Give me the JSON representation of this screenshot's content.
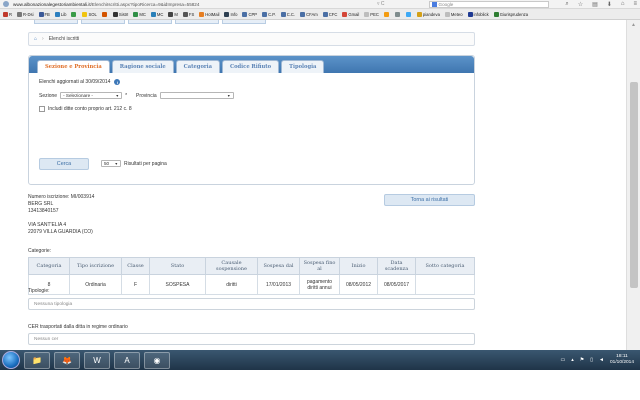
{
  "browser": {
    "url_host": "www.albonazionalegestoriambientali.it",
    "url_path": "/ElenchiIscritti.aspx?tipoRicerca=9&idImpresa=55824",
    "search_placeholder": "Google",
    "bookmarks": [
      {
        "label": "R",
        "icon": "r-icon",
        "color": "#c0392b"
      },
      {
        "label": "R-Dsi",
        "icon": "bookmark-icon",
        "color": "#777777"
      },
      {
        "label": "FB",
        "icon": "facebook-icon",
        "color": "#3b5998"
      },
      {
        "label": "Lib",
        "icon": "bookmark-icon",
        "color": "#2c7fbf"
      },
      {
        "label": "",
        "icon": "bookmark-icon",
        "color": "#3a9c47"
      },
      {
        "label": "SOL",
        "icon": "warning-icon",
        "color": "#f1c40f"
      },
      {
        "label": "",
        "icon": "bookmark-icon",
        "color": "#d35400"
      },
      {
        "label": "SistrI",
        "icon": "bookmark-icon",
        "color": "#333333"
      },
      {
        "label": "MC",
        "icon": "bookmark-icon",
        "color": "#2f8f46"
      },
      {
        "label": "MC",
        "icon": "bookmark-icon",
        "color": "#2980b9"
      },
      {
        "label": "M",
        "icon": "bookmark-icon",
        "color": "#444444"
      },
      {
        "label": "FS",
        "icon": "bookmark-icon",
        "color": "#555555"
      },
      {
        "label": "HotMail",
        "icon": "bookmark-icon",
        "color": "#e67e22"
      },
      {
        "label": "Info",
        "icon": "bookmark-icon",
        "color": "#2c3e50"
      },
      {
        "label": "CPP",
        "icon": "bookmark-icon",
        "color": "#4a6fa5"
      },
      {
        "label": "C.P.",
        "icon": "bookmark-icon",
        "color": "#4a6fa5"
      },
      {
        "label": "C.C.",
        "icon": "bookmark-icon",
        "color": "#4a6fa5"
      },
      {
        "label": "CFAm",
        "icon": "bookmark-icon",
        "color": "#4a6fa5"
      },
      {
        "label": "CFC",
        "icon": "bookmark-icon",
        "color": "#4a6fa5"
      },
      {
        "label": "Gmail",
        "icon": "gmail-icon",
        "color": "#d44638"
      },
      {
        "label": "PEC",
        "icon": "bookmark-icon",
        "color": "#bdbdbd"
      },
      {
        "label": "",
        "icon": "bookmark-icon",
        "color": "#f39c12"
      },
      {
        "label": "",
        "icon": "bookmark-icon",
        "color": "#7f8c8d"
      },
      {
        "label": "",
        "icon": "twitter-icon",
        "color": "#3fa9f5"
      },
      {
        "label": "piandeva",
        "icon": "bookmark-icon",
        "color": "#d4a017"
      },
      {
        "label": "Meteo",
        "icon": "bookmark-icon",
        "color": "#bdbdbd"
      },
      {
        "label": "infoblick",
        "icon": "bookmark-icon",
        "color": "#1f3a93"
      },
      {
        "label": "Giurisprudenza",
        "icon": "bookmark-icon",
        "color": "#2e7d32"
      }
    ]
  },
  "breadcrumb": {
    "current": "Elenchi iscritti"
  },
  "tabs": [
    {
      "label": "Sezione e Provincia",
      "active": true
    },
    {
      "label": "Ragione sociale",
      "active": false
    },
    {
      "label": "Categoria",
      "active": false
    },
    {
      "label": "Codice Rifiuto",
      "active": false
    },
    {
      "label": "Tipologia",
      "active": false
    }
  ],
  "form": {
    "updated": "Elenchi aggiornati al 30/09/2014",
    "sezione_label": "Sezione",
    "sezione_value": "- Selezionare -",
    "required_mark": "*",
    "provincia_label": "Provincia",
    "provincia_value": "",
    "checkbox_label": "Includi ditte conto proprio art. 212 c. 8",
    "search_button": "Cerca",
    "per_page_value": "50",
    "per_page_label": "Risultati per pagina"
  },
  "company": {
    "iscrizione": "Numero iscrizione: MI/003914",
    "name": "BERG SRL",
    "code": "13413840157",
    "address1": "VIA SANT'ELIA 4",
    "address2": "22079 VILLA GUARDIA (CO)"
  },
  "back_button": "Torna ai risultati",
  "categorie_label": "Categorie:",
  "table": {
    "headers": [
      "Categoria",
      "Tipo iscrizione",
      "Classe",
      "Stato",
      "Causale sospensione",
      "Sospesa dal",
      "Sospesa fino al",
      "Inizio",
      "Data scadenza",
      "Sotto categoria"
    ],
    "rows": [
      [
        "8",
        "Ordinaria",
        "F",
        "SOSPESA",
        "diritti",
        "17/01/2013",
        "pagamento diritti annui",
        "08/05/2012",
        "08/05/2017",
        ""
      ]
    ]
  },
  "tipologie": {
    "label": "Tipologie:",
    "value": "Nessuna tipologia"
  },
  "cer": {
    "label": "CER trasportati dalla ditta in regime ordinario",
    "value": "Nessun cer"
  },
  "taskbar": {
    "apps": [
      {
        "name": "explorer",
        "glyph": "📁"
      },
      {
        "name": "firefox",
        "glyph": "🦊"
      },
      {
        "name": "word",
        "glyph": "W"
      },
      {
        "name": "acrobat",
        "glyph": "A"
      },
      {
        "name": "chrome",
        "glyph": "◉"
      }
    ],
    "time": "18:11",
    "date": "01/10/2014"
  },
  "colors": {
    "accent": "#3f76b0",
    "active_tab": "#e0702a"
  }
}
